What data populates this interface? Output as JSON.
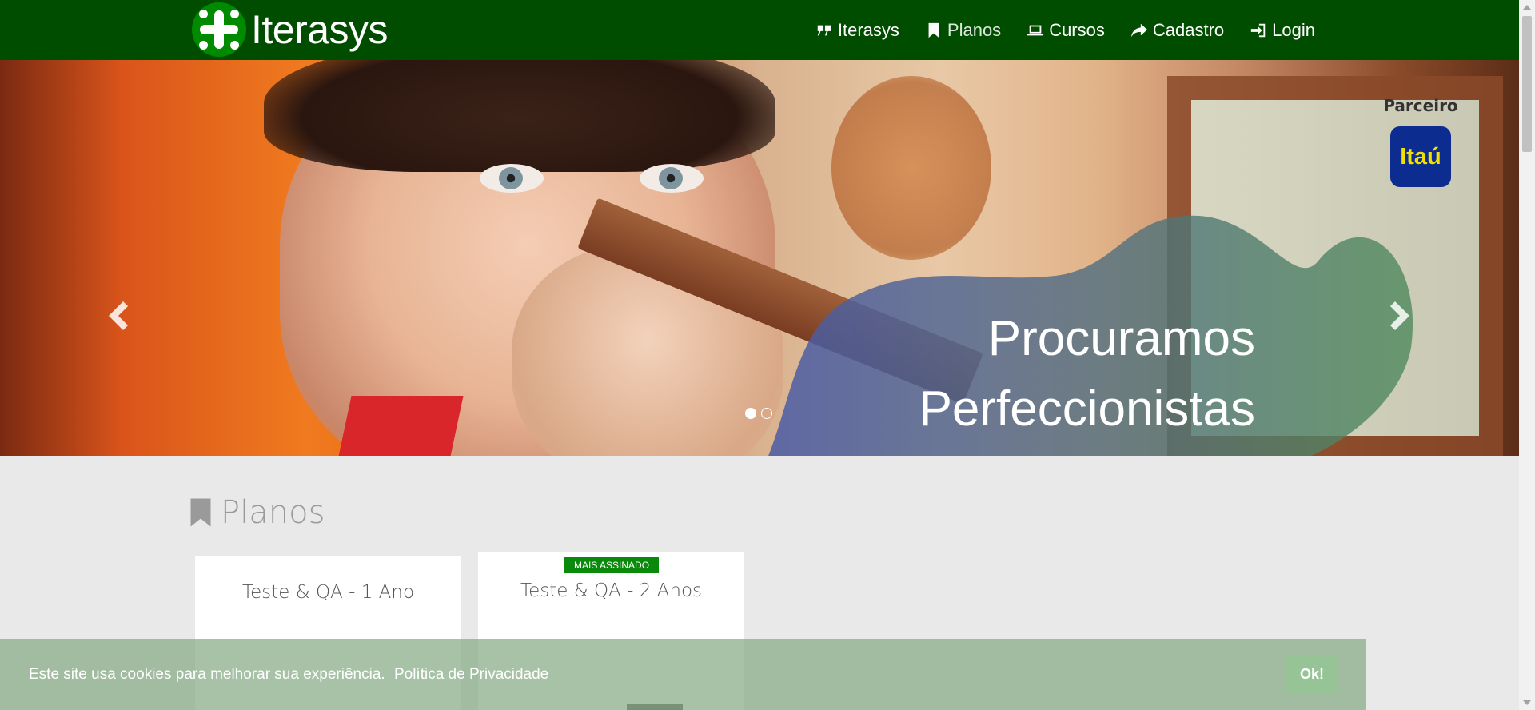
{
  "brand": {
    "name": "Iterasys"
  },
  "nav": {
    "items": [
      {
        "label": "Iterasys",
        "icon": "quote-icon"
      },
      {
        "label": "Planos",
        "icon": "bookmark-icon"
      },
      {
        "label": "Cursos",
        "icon": "laptop-icon"
      },
      {
        "label": "Cadastro",
        "icon": "share-icon"
      },
      {
        "label": "Login",
        "icon": "sign-in-icon"
      }
    ]
  },
  "hero": {
    "title_line1": "Procuramos",
    "title_line2": "Perfeccionistas",
    "partner_label": "Parceiro",
    "partner_logo_text": "Itaú",
    "slides_count": 2,
    "active_slide": 1
  },
  "plans_section": {
    "title": "Planos",
    "plans": [
      {
        "name": "Teste & QA - 1 Ano",
        "badge": ""
      },
      {
        "name": "Teste & QA - 2 Anos",
        "badge": "MAIS ASSINADO"
      }
    ]
  },
  "cookie": {
    "text": "Este site usa cookies para melhorar sua experiência.",
    "link_text": "Política de Privacidade",
    "button_label": "Ok!"
  },
  "colors": {
    "navbar": "#004d00",
    "brand_green": "#008a00",
    "badge_green": "#0a8a0a",
    "cookie_bar": "#87aa87",
    "cookie_button": "#97c497"
  }
}
